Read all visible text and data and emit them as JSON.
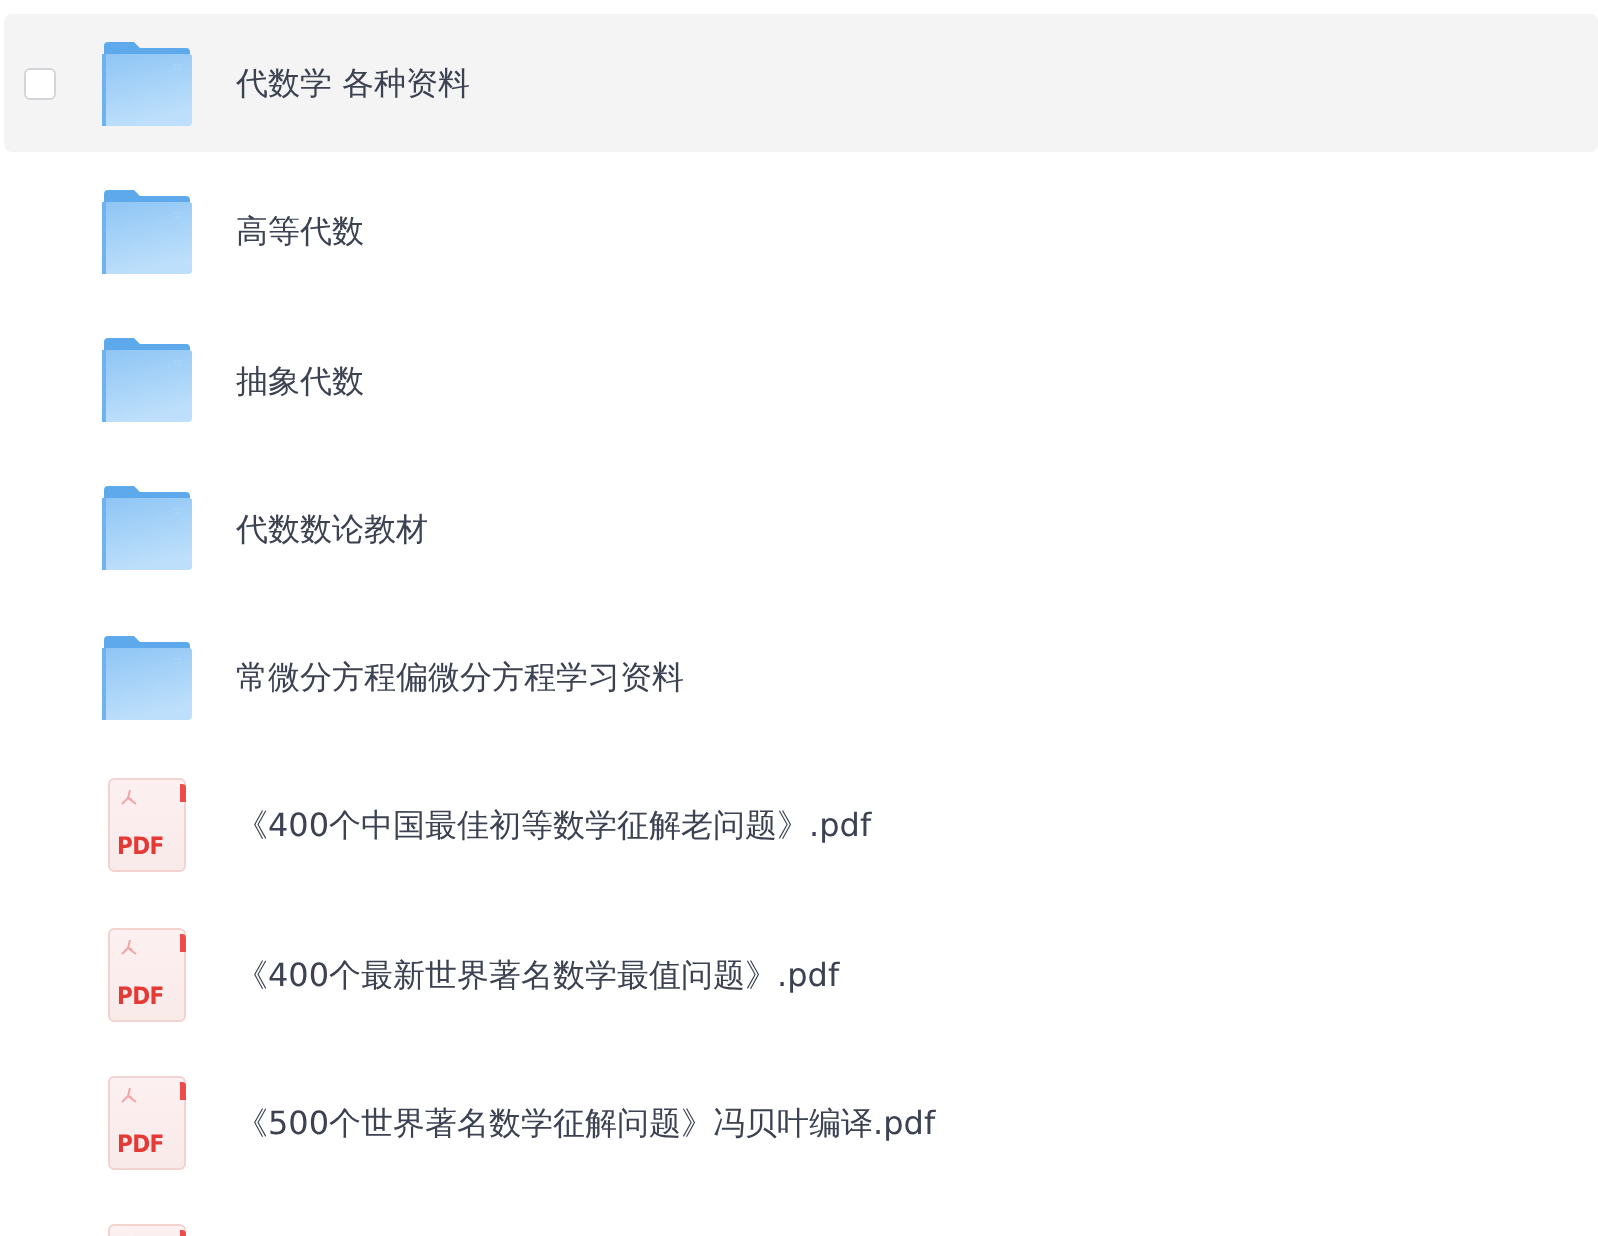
{
  "files": [
    {
      "kind": "folder",
      "name": "代数学 各种资料",
      "highlighted": true,
      "checked": false
    },
    {
      "kind": "folder",
      "name": "高等代数",
      "highlighted": false,
      "checked": false
    },
    {
      "kind": "folder",
      "name": "抽象代数",
      "highlighted": false,
      "checked": false
    },
    {
      "kind": "folder",
      "name": "代数数论教材",
      "highlighted": false,
      "checked": false
    },
    {
      "kind": "folder",
      "name": "常微分方程偏微分方程学习资料",
      "highlighted": false,
      "checked": false
    },
    {
      "kind": "pdf",
      "type_label": "PDF",
      "name": "《400个中国最佳初等数学征解老问题》.pdf",
      "highlighted": false,
      "checked": false
    },
    {
      "kind": "pdf",
      "type_label": "PDF",
      "name": "《400个最新世界著名数学最值问题》.pdf",
      "highlighted": false,
      "checked": false
    },
    {
      "kind": "pdf",
      "type_label": "PDF",
      "name": "《500个世界著名数学征解问题》冯贝叶编译.pdf",
      "highlighted": false,
      "checked": false
    },
    {
      "kind": "pdf"
    }
  ]
}
